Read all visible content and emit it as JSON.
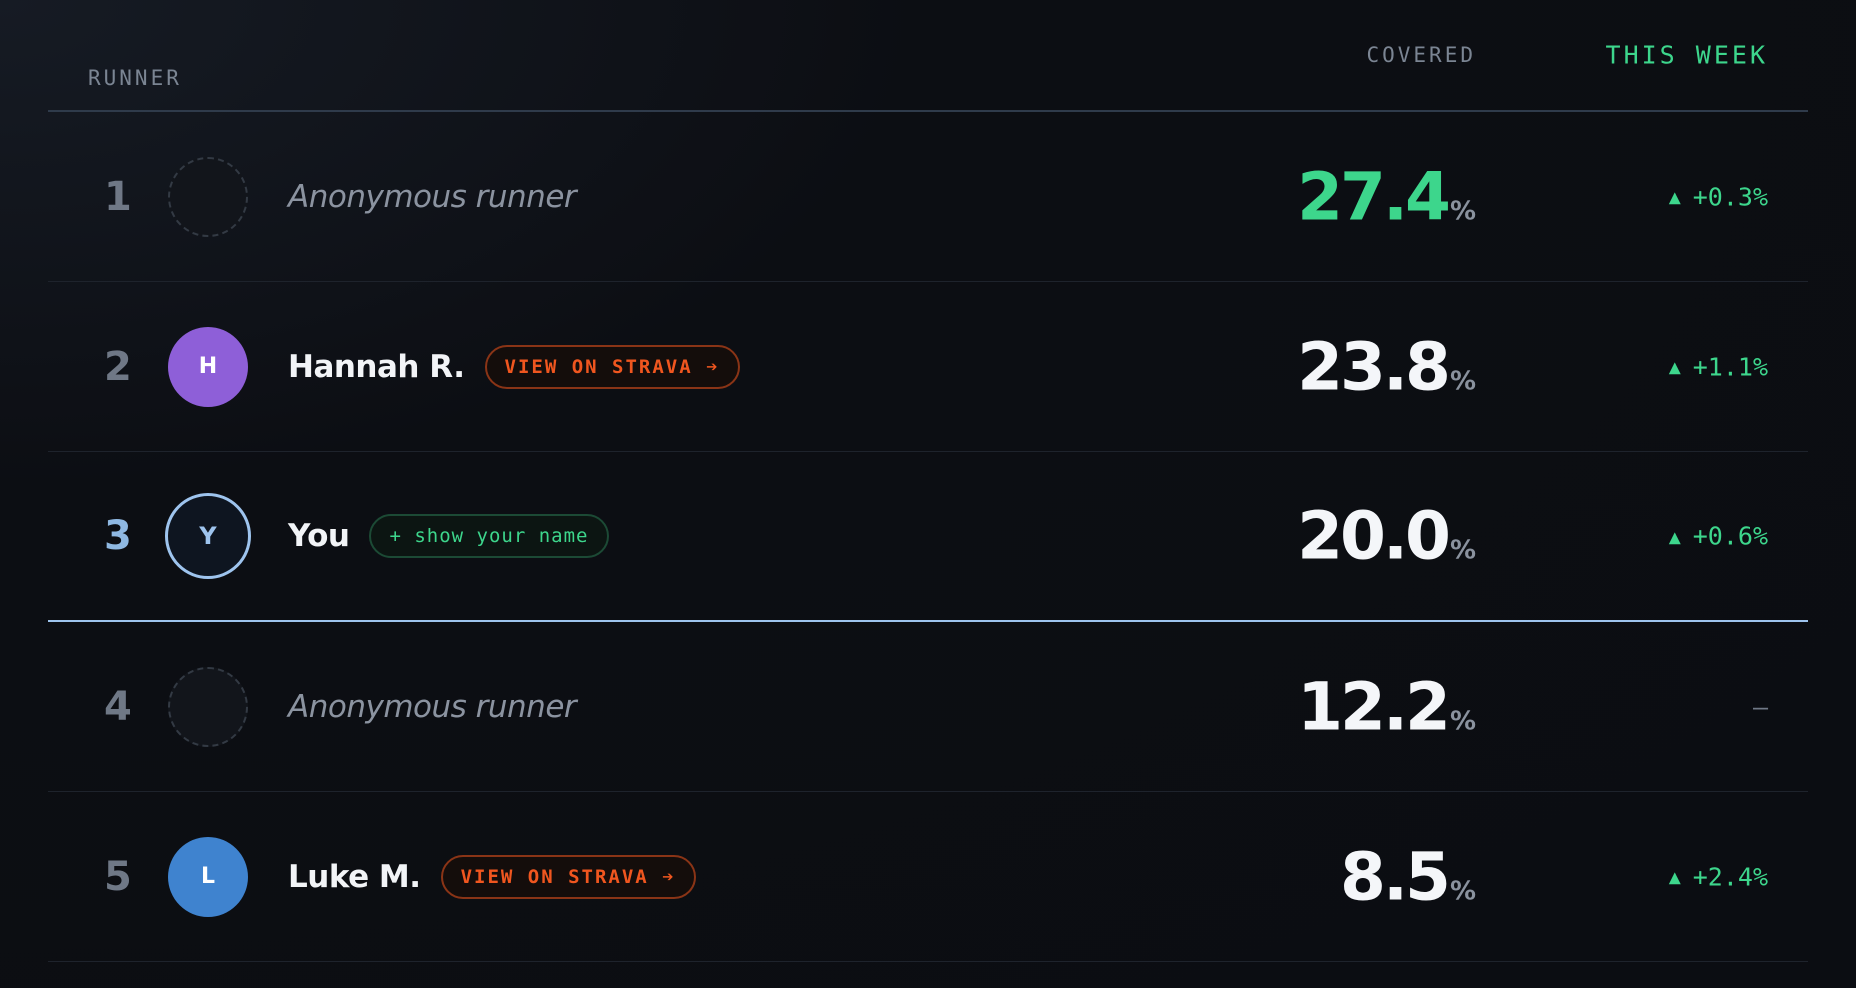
{
  "header": {
    "runner": "RUNNER",
    "covered": "COVERED",
    "this_week": "THIS WEEK"
  },
  "rows": [
    {
      "rank": "1",
      "avatar": "",
      "name": "Anonymous runner",
      "covered": "27.4",
      "pct": "%",
      "week": "+0.3%",
      "trend": "up"
    },
    {
      "rank": "2",
      "avatar": "H",
      "name": "Hannah R.",
      "action": "VIEW ON STRAVA ➔",
      "covered": "23.8",
      "pct": "%",
      "week": "+1.1%",
      "trend": "up",
      "avatar_color": "#8e5fd8"
    },
    {
      "rank": "3",
      "avatar": "Y",
      "name": "You",
      "action": "+ show your name",
      "covered": "20.0",
      "pct": "%",
      "week": "+0.6%",
      "trend": "up"
    },
    {
      "rank": "4",
      "avatar": "",
      "name": "Anonymous runner",
      "covered": "12.2",
      "pct": "%",
      "week": "–",
      "trend": "none"
    },
    {
      "rank": "5",
      "avatar": "L",
      "name": "Luke M.",
      "action": "VIEW ON STRAVA ➔",
      "covered": "8.5",
      "pct": "%",
      "week": "+2.4%",
      "trend": "up",
      "avatar_color": "#3f83cf"
    }
  ],
  "icons": {
    "trend_up": "triangle-up-icon"
  },
  "colors": {
    "accent_green": "#3dd68c",
    "strava_orange": "#f0561f",
    "you_highlight": "#9ec4ee",
    "background": "#0c0e13"
  }
}
